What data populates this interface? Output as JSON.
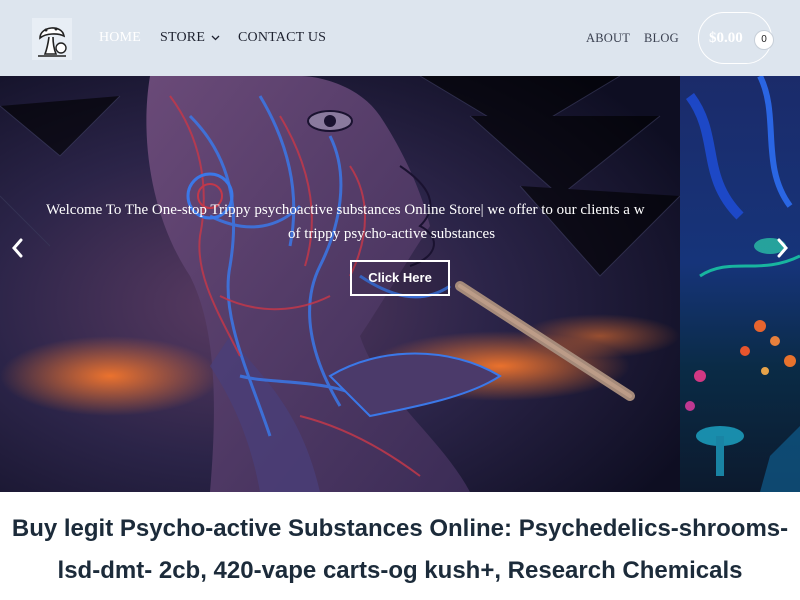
{
  "header": {
    "nav": {
      "home": "HOME",
      "store": "STORE",
      "contact": "CONTACT US",
      "about": "ABOUT",
      "blog": "BLOG"
    },
    "cart": {
      "total": "$0.00",
      "count": "0"
    },
    "logo_icon": "mushroom-logo"
  },
  "hero": {
    "text_line1": "Welcome To The One-stop Trippy psychoactive substances Online Store| we offer to our clients a w",
    "text_line2": "of trippy psycho-active substances",
    "button_label": "Click Here",
    "prev_icon": "chevron-left-icon",
    "next_icon": "chevron-right-icon"
  },
  "main": {
    "title_line1": "Buy legit Psycho-active Substances Online: Psychedelics-shrooms-",
    "title_line2": "lsd-dmt- 2cb, 420-vape carts-og kush+, Research Chemicals"
  },
  "colors": {
    "header_bg": "#dde5ee",
    "heading_text": "#1c2b3a",
    "nav_text": "#1e2230",
    "active_nav": "#ffffff"
  }
}
